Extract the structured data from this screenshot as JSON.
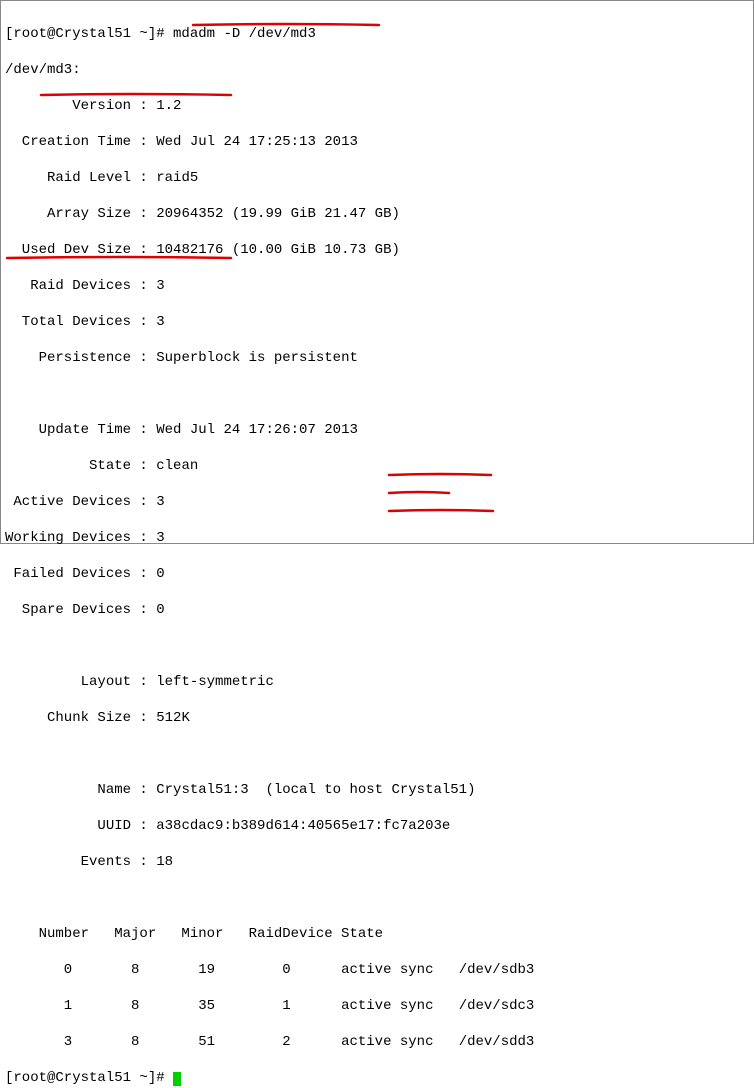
{
  "prompt1": {
    "prefix": "[root@Crystal51 ~]# ",
    "command": "mdadm -D /dev/md3"
  },
  "device_line": "/dev/md3:",
  "fields": {
    "version_label": "        Version : ",
    "version_value": "1.2",
    "creation_label": "  Creation Time : ",
    "creation_value": "Wed Jul 24 17:25:13 2013",
    "raidlevel_label": "     Raid Level : ",
    "raidlevel_value": "raid5",
    "arraysize_label": "     Array Size : ",
    "arraysize_value": "20964352 (19.99 GiB 21.47 GB)",
    "useddev_label": "  Used Dev Size : ",
    "useddev_value": "10482176 (10.00 GiB 10.73 GB)",
    "raiddev_label": "   Raid Devices : ",
    "raiddev_value": "3",
    "totaldev_label": "  Total Devices : ",
    "totaldev_value": "3",
    "persist_label": "    Persistence : ",
    "persist_value": "Superblock is persistent",
    "updatetime_label": "    Update Time : ",
    "updatetime_value": "Wed Jul 24 17:26:07 2013",
    "state_label": "          State : ",
    "state_value": "clean",
    "activedev_label": " Active Devices : ",
    "activedev_value": "3",
    "workingdev_label": "Working Devices : ",
    "workingdev_value": "3",
    "faileddev_label": " Failed Devices : ",
    "faileddev_value": "0",
    "sparedev_label": "  Spare Devices : ",
    "sparedev_value": "0",
    "layout_label": "         Layout : ",
    "layout_value": "left-symmetric",
    "chunk_label": "     Chunk Size : ",
    "chunk_value": "512K",
    "name_label": "           Name : ",
    "name_value": "Crystal51:3  (local to host Crystal51)",
    "uuid_label": "           UUID : ",
    "uuid_value": "a38cdac9:b389d614:40565e17:fc7a203e",
    "events_label": "         Events : ",
    "events_value": "18"
  },
  "device_table": {
    "header": "    Number   Major   Minor   RaidDevice State",
    "rows": [
      {
        "cols": "       0       8       19        0      ",
        "state": "active sync",
        "dev": "   /dev/sdb3"
      },
      {
        "cols": "       1       8       35        1      ",
        "state": "active sync",
        "dev": "   /dev/sdc3"
      },
      {
        "cols": "       3       8       51        2      ",
        "state": "active sync",
        "dev": "   /dev/sdd3"
      }
    ]
  },
  "prompt2": {
    "prefix": "[root@Crystal51 ~]# "
  }
}
